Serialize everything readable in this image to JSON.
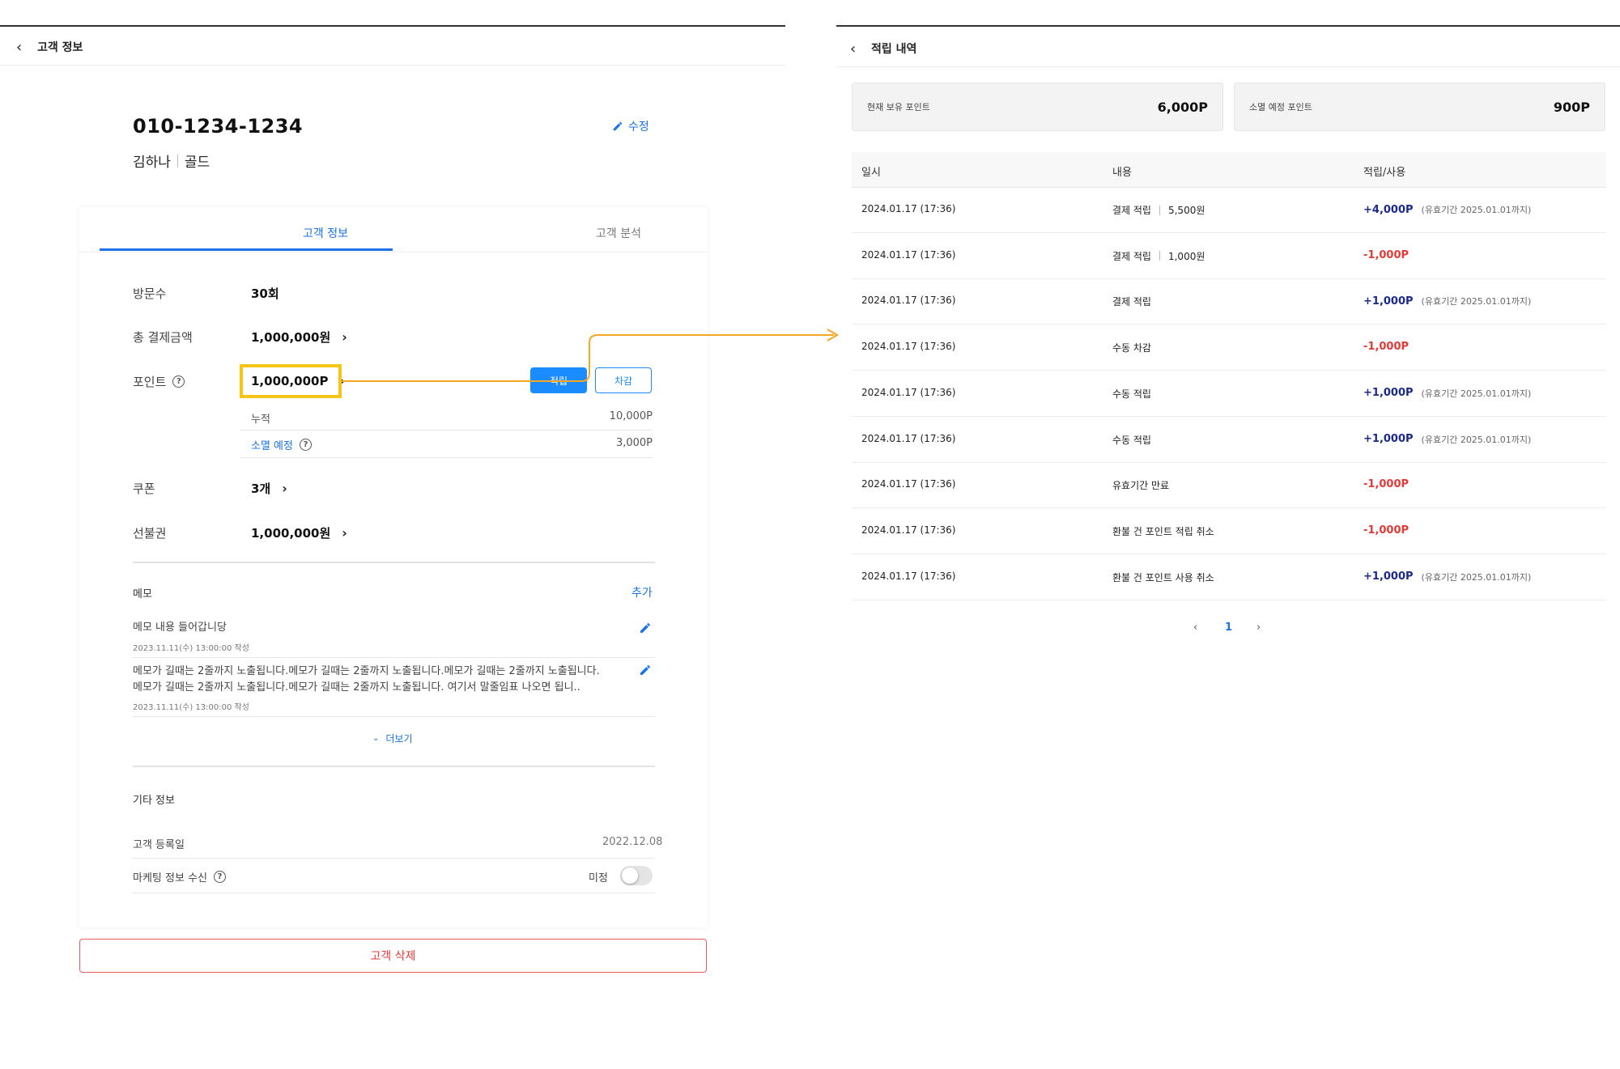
{
  "left": {
    "header": {
      "title": "고객 정보"
    },
    "customer": {
      "phone": "010-1234-1234",
      "name": "김하나",
      "grade": "골드",
      "edit_label": "수정"
    },
    "tabs": [
      {
        "label": "고객 정보"
      },
      {
        "label": "고객 분석"
      }
    ],
    "rows": {
      "visits": {
        "label": "방문수",
        "value": "30회"
      },
      "total_pay": {
        "label": "총 결제금액",
        "value": "1,000,000원"
      },
      "points": {
        "label": "포인트",
        "value": "1,000,000P"
      },
      "coupon": {
        "label": "쿠폰",
        "value": "3개"
      },
      "prepaid": {
        "label": "선불권",
        "value": "1,000,000원"
      }
    },
    "point_buttons": {
      "earn": "적립",
      "deduct": "차감"
    },
    "point_sub": {
      "accum": {
        "label": "누적",
        "value": "10,000P"
      },
      "expire": {
        "label": "소멸 예정",
        "value": "3,000P"
      }
    },
    "memo": {
      "title": "메모",
      "add_label": "추가",
      "items": [
        {
          "text": "메모 내용 들어갑니당",
          "date": "2023.11.11(수) 13:00:00 작성"
        },
        {
          "text": "메모가 길때는 2줄까지 노출됩니다.메모가 길때는 2줄까지 노출됩니다.메모가 길때는 2줄까지 노출됩니다.메모가 길때는 2줄까지 노출됩니다.메모가 길때는 2줄까지 노출됩니다. 여기서 말줄임표 나오면 됩니..",
          "date": "2023.11.11(수) 13:00:00 작성"
        }
      ],
      "more_label": "더보기"
    },
    "etc": {
      "title": "기타 정보",
      "register": {
        "label": "고객 등록일",
        "value": "2022.12.08"
      },
      "marketing": {
        "label": "마케팅 정보 수신",
        "value": "미정",
        "toggle_on": false
      }
    },
    "delete_label": "고객 삭제"
  },
  "right": {
    "header": {
      "title": "적립 내역"
    },
    "summary": [
      {
        "label": "현재 보유 포인트",
        "value": "6,000P"
      },
      {
        "label": "소멸 예정 포인트",
        "value": "900P"
      }
    ],
    "columns": [
      "일시",
      "내용",
      "적립/사용"
    ],
    "rows": [
      {
        "date": "2024.01.17 (17:36)",
        "content": "결제 적립",
        "extra": "5,500원",
        "amount": "+4,000P",
        "sign": "plus",
        "expiry": "(유효기간 2025.01.01까지)"
      },
      {
        "date": "2024.01.17 (17:36)",
        "content": "결제 적립",
        "extra": "1,000원",
        "amount": "-1,000P",
        "sign": "minus",
        "expiry": ""
      },
      {
        "date": "2024.01.17 (17:36)",
        "content": "결제 적립",
        "extra": "",
        "amount": "+1,000P",
        "sign": "plus",
        "expiry": "(유효기간 2025.01.01까지)"
      },
      {
        "date": "2024.01.17 (17:36)",
        "content": "수동 차감",
        "extra": "",
        "amount": "-1,000P",
        "sign": "minus",
        "expiry": ""
      },
      {
        "date": "2024.01.17 (17:36)",
        "content": "수동 적립",
        "extra": "",
        "amount": "+1,000P",
        "sign": "plus",
        "expiry": "(유효기간 2025.01.01까지)"
      },
      {
        "date": "2024.01.17 (17:36)",
        "content": "수동 적립",
        "extra": "",
        "amount": "+1,000P",
        "sign": "plus",
        "expiry": "(유효기간 2025.01.01까지)"
      },
      {
        "date": "2024.01.17 (17:36)",
        "content": "유효기간 만료",
        "extra": "",
        "amount": "-1,000P",
        "sign": "minus",
        "expiry": ""
      },
      {
        "date": "2024.01.17 (17:36)",
        "content": "환불 건 포인트 적립 취소",
        "extra": "",
        "amount": "-1,000P",
        "sign": "minus",
        "expiry": ""
      },
      {
        "date": "2024.01.17 (17:36)",
        "content": "환불 건 포인트 사용 취소",
        "extra": "",
        "amount": "+1,000P",
        "sign": "plus",
        "expiry": "(유효기간 2025.01.01까지)"
      }
    ],
    "pagination": {
      "current": "1"
    }
  },
  "colors": {
    "accent": "#1a73e8",
    "highlight": "#f5c518",
    "arrow": "#f5a623",
    "minus": "#e53935",
    "plus": "#1b2a8a",
    "danger": "#e83a3a"
  },
  "icons": {
    "back": "chevron-left-icon",
    "edit": "pencil-icon",
    "help": "question-circle-icon",
    "next": "chevron-right-icon",
    "more": "chevron-down-icon"
  }
}
